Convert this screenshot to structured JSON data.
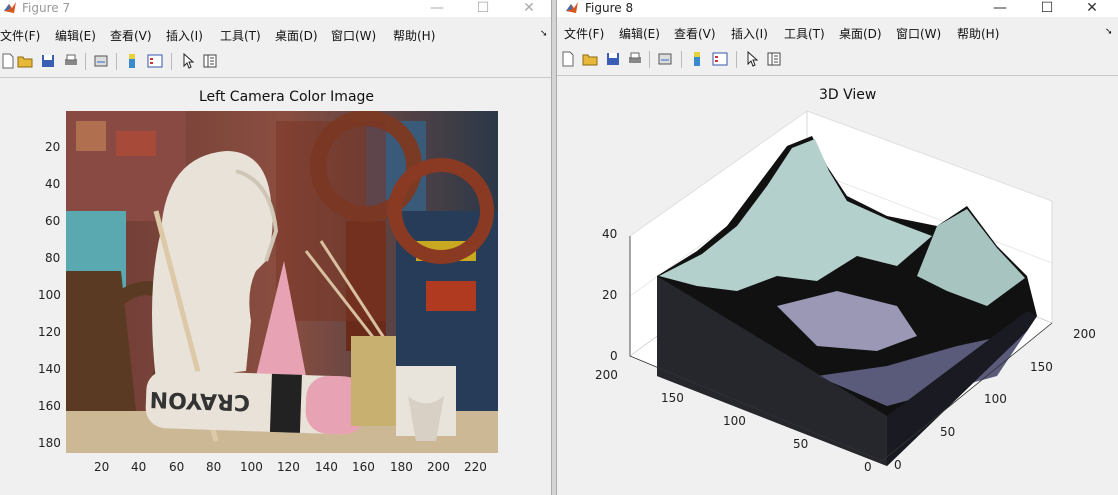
{
  "figure7": {
    "title": "Figure 7",
    "menu": [
      "文件(F)",
      "编辑(E)",
      "查看(V)",
      "插入(I)",
      "工具(T)",
      "桌面(D)",
      "窗口(W)",
      "帮助(H)"
    ],
    "axes_title": "Left Camera Color Image",
    "y_ticks": [
      "20",
      "40",
      "60",
      "80",
      "100",
      "120",
      "140",
      "160",
      "180"
    ],
    "x_ticks": [
      "20",
      "40",
      "60",
      "80",
      "100",
      "120",
      "140",
      "160",
      "180",
      "200",
      "220"
    ],
    "image_text": "CRAYON",
    "image_colors": {
      "bust": "#e8e2d8",
      "ring": "#8a3a22",
      "pencil": "#ddc8a8",
      "eraser": "#e7a2b4",
      "table": "#cdb896",
      "background": "#6b4a3c"
    }
  },
  "figure8": {
    "title": "Figure 8",
    "menu": [
      "文件(F)",
      "编辑(E)",
      "查看(V)",
      "插入(I)",
      "工具(T)",
      "桌面(D)",
      "窗口(W)",
      "帮助(H)"
    ],
    "axes_title": "3D View",
    "z_ticks": [
      "40",
      "20",
      "0"
    ],
    "left_axis_ticks": [
      "200",
      "150",
      "100",
      "50",
      "0"
    ],
    "right_axis_ticks": [
      "200",
      "150",
      "100",
      "50",
      "0"
    ],
    "surface_colors": {
      "top": "#b4d0cc",
      "mid": "#8c8aa8",
      "low": "#4a4a6a",
      "walls": "#111111"
    }
  },
  "window_controls": {
    "minimize": "—",
    "maximize": "☐",
    "close": "✕"
  }
}
